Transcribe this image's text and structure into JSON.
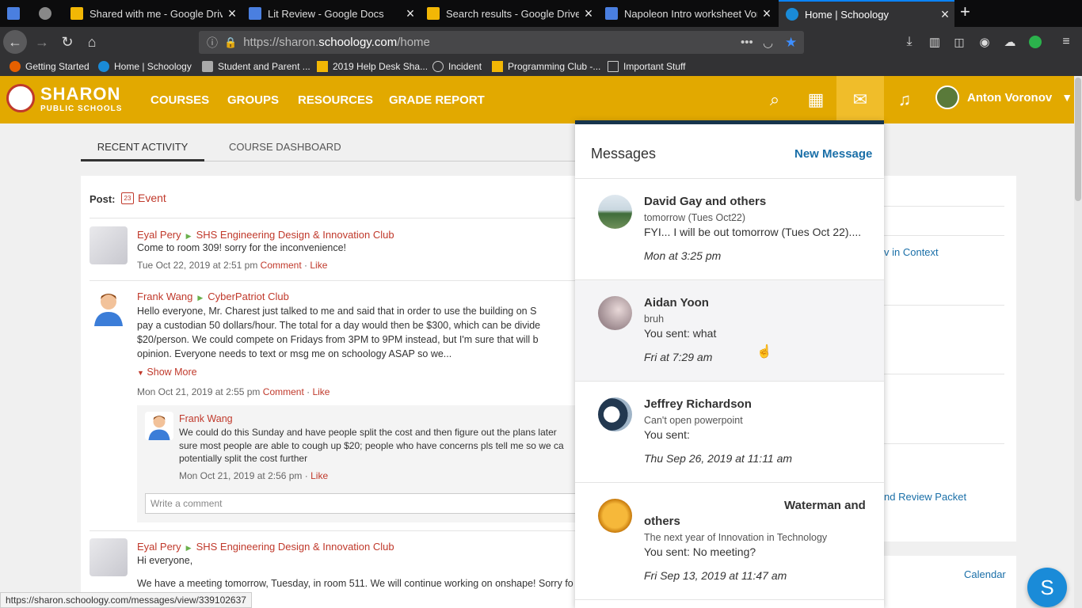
{
  "browser": {
    "tabs": [
      {
        "title": "",
        "color": "#4a7fe0"
      },
      {
        "title": "",
        "color": "#888888"
      },
      {
        "title": "Shared with me - Google Drive",
        "color": "#f2b705"
      },
      {
        "title": "Lit Review - Google Docs",
        "color": "#4a7fe0"
      },
      {
        "title": "Search results - Google Drive",
        "color": "#f2b705"
      },
      {
        "title": "Napoleon Intro worksheet Voro",
        "color": "#4a7fe0"
      },
      {
        "title": "Home | Schoology",
        "color": "#1a8bd8"
      }
    ],
    "url_prefix": "https://sharon.",
    "url_domain": "schoology.com",
    "url_path": "/home",
    "bookmarks": [
      "Getting Started",
      "Home | Schoology",
      "Student and Parent ...",
      "2019 Help Desk Sha...",
      "Incident",
      "Programming Club -...",
      "Important Stuff"
    ]
  },
  "header": {
    "logo_line1": "SHARON",
    "logo_line2": "PUBLIC SCHOOLS",
    "nav": [
      "COURSES",
      "GROUPS",
      "RESOURCES",
      "GRADE REPORT"
    ],
    "user_name": "Anton Voronov",
    "accent": "#e2a900"
  },
  "subtabs": [
    "RECENT ACTIVITY",
    "COURSE DASHBOARD"
  ],
  "feed": {
    "post_label": "Post:",
    "event_label": "Event",
    "event_cal_day": "23",
    "posts": [
      {
        "author": "Eyal Pery",
        "group": "SHS Engineering Design & Innovation Club",
        "body": "Come to room 309! sorry for the inconvenience!",
        "date": "Tue Oct 22, 2019 at 2:51 pm",
        "comment": "Comment",
        "like": "Like"
      },
      {
        "author": "Frank Wang",
        "group": "CyberPatriot Club",
        "body_lines": [
          "Hello everyone, Mr. Charest just talked to me and said that in order to use the building on S",
          "pay a custodian 50 dollars/hour. The total for a day would then be $300, which can be divide",
          "$20/person. We could compete on Fridays from 3PM to 9PM instead, but I'm sure that will b",
          "opinion. Everyone needs to text or msg me on schoology ASAP so we..."
        ],
        "show_more": "Show More",
        "date": "Mon Oct 21, 2019 at 2:55 pm",
        "comment": "Comment",
        "like": "Like",
        "reply": {
          "author": "Frank Wang",
          "lines": [
            "We could do this Sunday and have people split the cost and then figure out the plans later",
            "sure most people are able to cough up $20; people who have concerns pls tell me so we ca",
            "potentially split the cost further"
          ],
          "date": "Mon Oct 21, 2019 at 2:56 pm",
          "like": "Like"
        },
        "comment_placeholder": "Write a comment"
      },
      {
        "author": "Eyal Pery",
        "group": "SHS Engineering Design & Innovation Club",
        "body": "Hi everyone,",
        "body2": "We have a meeting tomorrow, Tuesday, in room 511. We will continue working on onshape! Sorry fo"
      }
    ]
  },
  "right_links": [
    "v in Context",
    "nd Review Packet",
    "Calendar"
  ],
  "messages": {
    "title": "Messages",
    "new_message": "New Message",
    "items": [
      {
        "from": "David Gay and others",
        "subject": "tomorrow (Tues Oct22)",
        "preview": "FYI... I will be out tomorrow (Tues Oct 22)....",
        "time": "Mon at 3:25 pm"
      },
      {
        "from": "Aidan Yoon",
        "subject": "bruh",
        "preview": "You sent: what",
        "time": "Fri at 7:29 am"
      },
      {
        "from": "Jeffrey Richardson",
        "subject": "Can't open powerpoint",
        "preview": "You sent:",
        "time": "Thu Sep 26, 2019 at 11:11 am"
      },
      {
        "from": "Waterman and",
        "from2": "others",
        "subject": "The next year of Innovation in Technology",
        "preview": "You sent: No meeting?",
        "time": "Fri Sep 13, 2019 at 11:47 am"
      }
    ]
  },
  "status_url": "https://sharon.schoology.com/messages/view/339102637",
  "fab_letter": "S"
}
